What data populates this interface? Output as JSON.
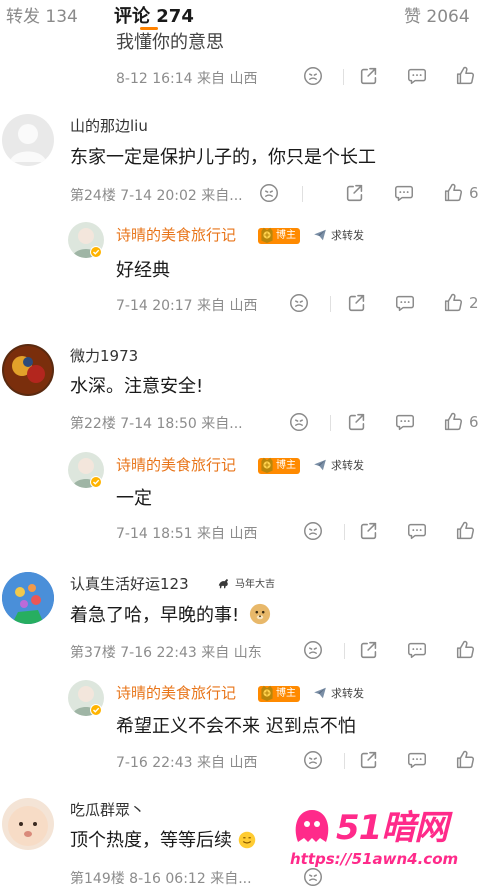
{
  "tabs": [
    {
      "label": "转发 134"
    },
    {
      "label": "评论 274"
    },
    {
      "label": "赞 2064"
    }
  ],
  "top_partial": {
    "content": "我懂你的意思",
    "meta": "8-12 16:14 来自 山西"
  },
  "comments": [
    {
      "user": "山的那边liu",
      "content": "东家一定是保护儿子的，你只是个长工",
      "meta": "第24楼 7-14 20:02 来自...",
      "like_count": "6",
      "reply": {
        "user": "诗晴的美食旅行记",
        "badge": "博主",
        "tag": "求转发",
        "content": "好经典",
        "meta": "7-14 20:17 来自 山西",
        "like_count": "2"
      }
    },
    {
      "user": "微力1973",
      "content": "水深。注意安全!",
      "meta": "第22楼 7-14 18:50 来自...",
      "like_count": "6",
      "reply": {
        "user": "诗晴的美食旅行记",
        "badge": "博主",
        "tag": "求转发",
        "content": "一定",
        "meta": "7-14 18:51 来自 山西",
        "like_count": ""
      }
    },
    {
      "user": "认真生活好运123",
      "user_tag": "马年大吉",
      "content": "着急了哈，早晚的事!",
      "meta": "第37楼 7-16 22:43 来自 山东",
      "like_count": "",
      "reply": {
        "user": "诗晴的美食旅行记",
        "badge": "博主",
        "tag": "求转发",
        "content": "希望正义不会不来 迟到点不怕",
        "meta": "7-16 22:43 来自 山西",
        "like_count": ""
      }
    },
    {
      "user": "吃瓜群眾丶",
      "content": "顶个热度，等等后续",
      "meta": "第149楼 8-16 06:12 来自...",
      "like_count": ""
    }
  ],
  "watermark": {
    "brand": "51暗网",
    "url": "https://51awn4.com"
  },
  "colors": {
    "accent": "#ff8200",
    "reply_name": "#e8751a",
    "watermark": "#ff2a8a"
  }
}
